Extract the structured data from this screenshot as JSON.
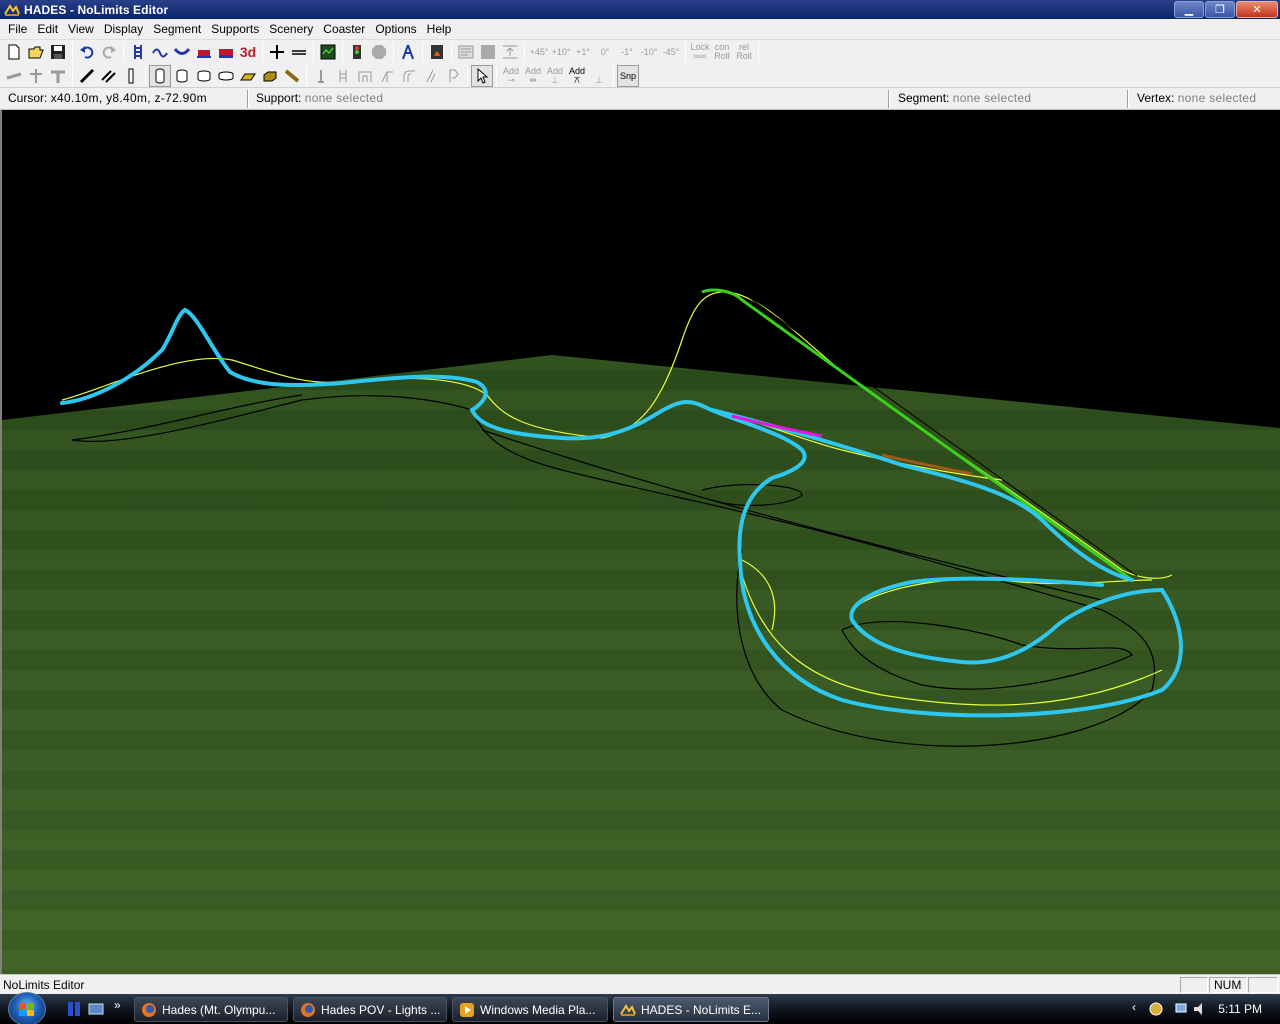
{
  "window": {
    "title": "HADES - NoLimits Editor",
    "controls": [
      "minimize",
      "maximize",
      "close"
    ]
  },
  "menu": [
    "File",
    "Edit",
    "View",
    "Display",
    "Segment",
    "Supports",
    "Scenery",
    "Coaster",
    "Options",
    "Help"
  ],
  "toolbar1": {
    "labels": {
      "three_d": "3d",
      "plus45": "+45°",
      "plus10": "+10°",
      "plus1": "+1°",
      "zero": "0°",
      "minus1": "-1°",
      "minus10": "-10°",
      "minus45": "-45°",
      "lock_roll_top": "Lock",
      "lock_roll_bot": "∞∞",
      "con_roll_top": "con",
      "con_roll_bot": "Roll",
      "rel_roll_top": "rel",
      "rel_roll_bot": "Roll"
    }
  },
  "toolbar2": {
    "add_label": "Add",
    "snap_label": "Snp"
  },
  "status": {
    "cursor_label": "Cursor:",
    "cursor_value": "x40.10m, y8.40m, z-72.90m",
    "support_label": "Support:",
    "support_value": "none selected",
    "segment_label": "Segment:",
    "segment_value": "none selected",
    "vertex_label": "Vertex:",
    "vertex_value": "none selected"
  },
  "app_status": {
    "message": "NoLimits Editor",
    "num": "NUM"
  },
  "taskbar": {
    "tasks": [
      {
        "label": "Hades (Mt. Olympu..."
      },
      {
        "label": "Hades POV - Lights ..."
      },
      {
        "label": "Windows Media Pla..."
      },
      {
        "label": "HADES - NoLimits E..."
      }
    ],
    "clock": "5:11 PM"
  },
  "colors": {
    "track": "#2ec7f0",
    "rail": "#e6ff3a",
    "lift": "#39d11a",
    "shadow": "#000000",
    "ground_dark": "#2c4a1c",
    "ground_light": "#4e7433",
    "brake_magenta": "#e11ad8",
    "brake_orange": "#a05a12"
  }
}
